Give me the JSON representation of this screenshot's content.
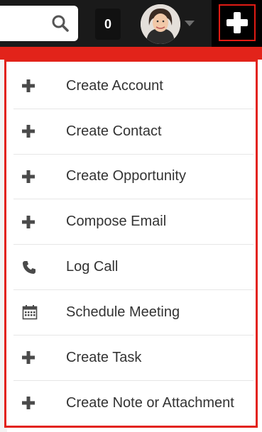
{
  "header": {
    "notification_count": "0"
  },
  "quick_create_menu": {
    "items": [
      {
        "label": "Create Account",
        "icon": "plus-icon"
      },
      {
        "label": "Create Contact",
        "icon": "plus-icon"
      },
      {
        "label": "Create Opportunity",
        "icon": "plus-icon"
      },
      {
        "label": "Compose Email",
        "icon": "plus-icon"
      },
      {
        "label": "Log Call",
        "icon": "phone-icon"
      },
      {
        "label": "Schedule Meeting",
        "icon": "calendar-icon"
      },
      {
        "label": "Create Task",
        "icon": "plus-icon"
      },
      {
        "label": "Create Note or Attachment",
        "icon": "plus-icon"
      }
    ]
  },
  "colors": {
    "topbar": "#1a1a1a",
    "highlight": "#e2231a",
    "menu_text": "#333333",
    "icon": "#4a4a4a"
  }
}
